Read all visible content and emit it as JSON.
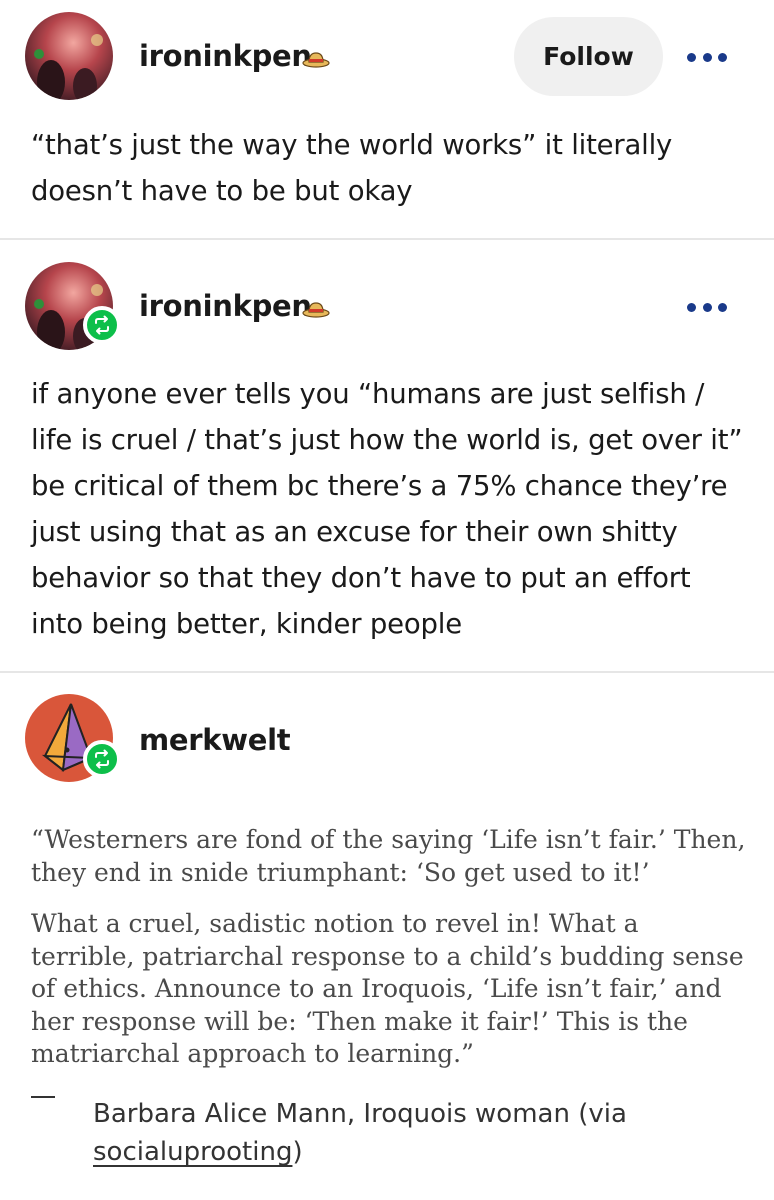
{
  "posts": [
    {
      "username": "ironinkpen",
      "follow_label": "Follow",
      "text": "“that’s just the way the world works” it literally doesn’t have to be but okay"
    },
    {
      "username": "ironinkpen",
      "text": "if anyone ever tells you “humans are just selfish / life is cruel / that’s just how the world is, get over it” be critical of them bc there’s a 75% chance they’re just using that as an excuse for their own shitty behavior so that they don’t have to put an effort into being better, kinder people"
    },
    {
      "username": "merkwelt",
      "quote_p1": "“Westerners are fond of the saying ‘Life isn’t fair.’ Then, they end in snide triumphant: ‘So get used to it!’",
      "quote_p2": "What a cruel, sadistic notion to revel in! What a terrible, patriarchal response to a child’s budding sense of ethics. Announce to an Iroquois, ‘Life isn’t fair,’ and her response will be: ‘Then make it fair!’ This is the matriarchal approach to learning.”",
      "attribution_text": "Barbara Alice Mann, Iroquois woman (via ",
      "attribution_link": "socialuprooting",
      "attribution_close": ")"
    }
  ],
  "icons": {
    "hat": "straw-hat-icon",
    "more": "more-options-icon",
    "reblog": "reblog-icon"
  },
  "colors": {
    "reblog_badge": "#0dbf4a",
    "more_dots": "#1a3a8a",
    "follow_bg": "#f0f0f0"
  }
}
